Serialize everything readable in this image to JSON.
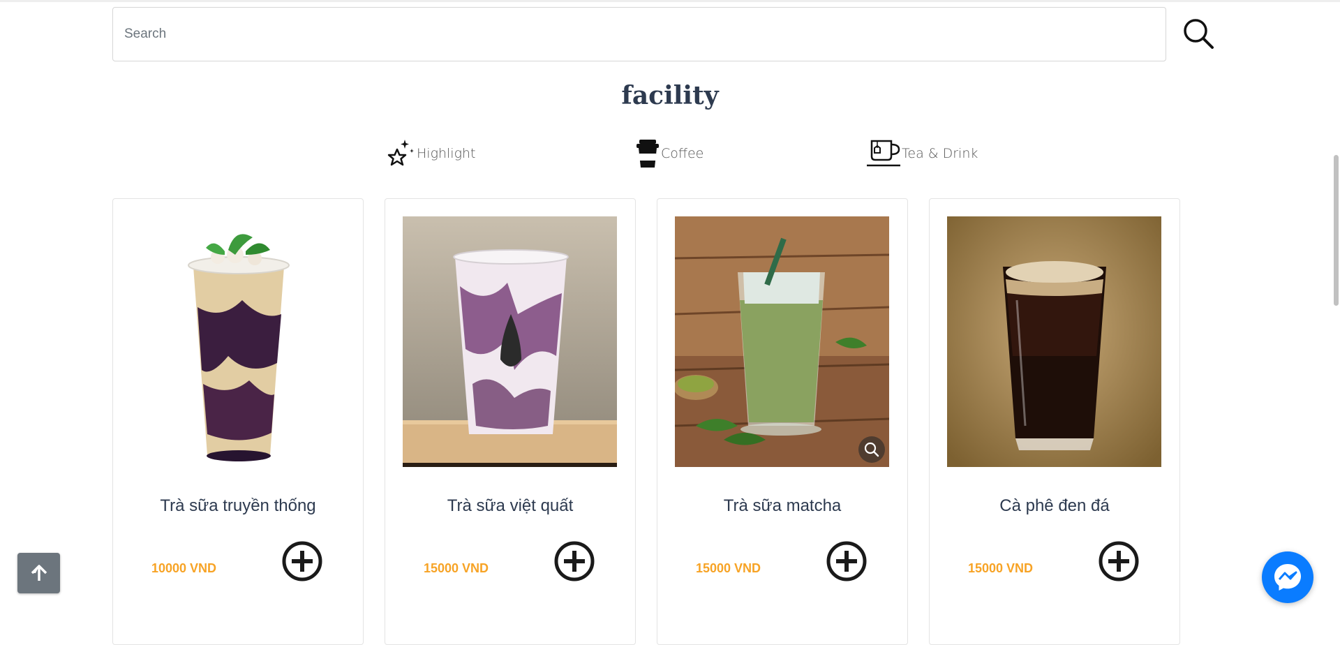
{
  "search": {
    "placeholder": "Search"
  },
  "section": {
    "title": "facility"
  },
  "categories": [
    {
      "label": "Highlight",
      "icon": "sparkle-star-icon"
    },
    {
      "label": "Coffee",
      "icon": "coffee-cup-icon"
    },
    {
      "label": "Tea & Drink",
      "icon": "tea-cup-icon"
    }
  ],
  "products": [
    {
      "name": "Trà sữa truyền thống",
      "price": "10000 VND"
    },
    {
      "name": "Trà sữa việt quất",
      "price": "15000 VND"
    },
    {
      "name": "Trà sữa matcha",
      "price": "15000 VND"
    },
    {
      "name": "Cà phê đen đá",
      "price": "15000 VND"
    }
  ],
  "colors": {
    "price": "#f7a325",
    "title": "#2d3a4f",
    "messenger": "#0a7cff",
    "back_top": "#6c757d"
  }
}
